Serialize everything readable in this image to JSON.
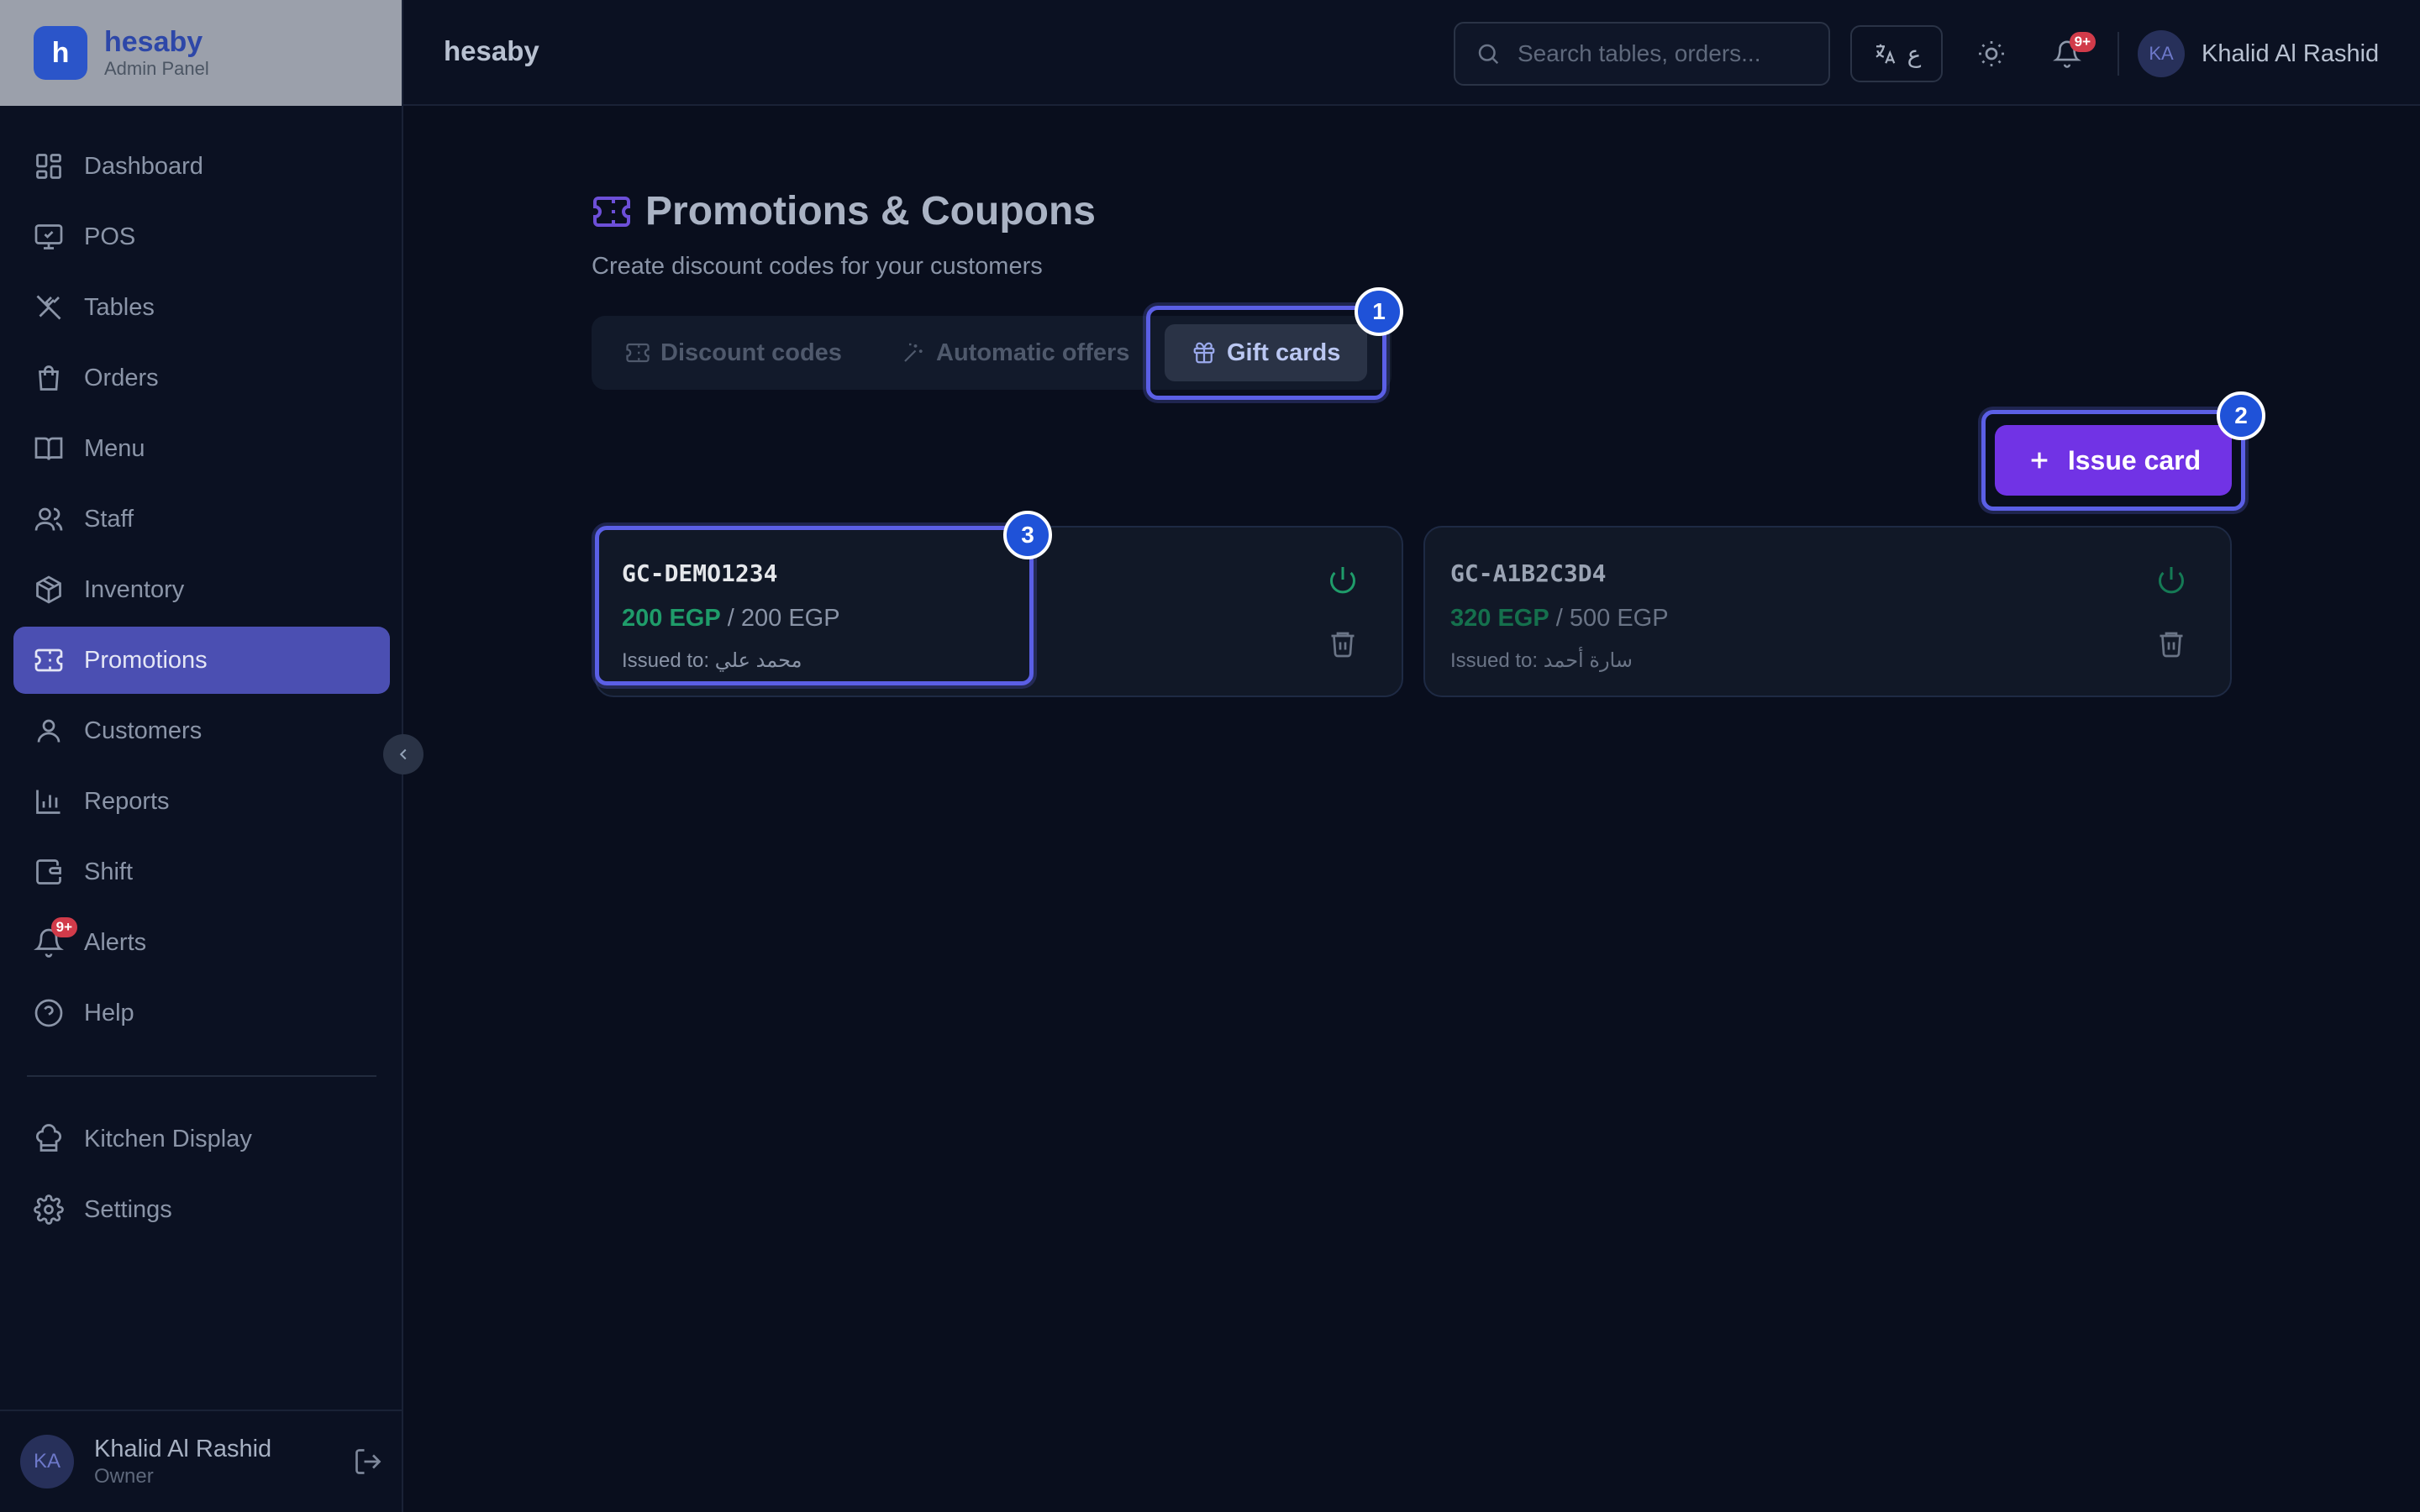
{
  "brand": {
    "logo_letter": "h",
    "name": "hesaby",
    "subtitle": "Admin Panel"
  },
  "sidebar": {
    "items": [
      {
        "label": "Dashboard",
        "icon": "dashboard-icon"
      },
      {
        "label": "POS",
        "icon": "pos-icon"
      },
      {
        "label": "Tables",
        "icon": "utensils-icon"
      },
      {
        "label": "Orders",
        "icon": "shopping-bag-icon"
      },
      {
        "label": "Menu",
        "icon": "book-icon"
      },
      {
        "label": "Staff",
        "icon": "users-icon"
      },
      {
        "label": "Inventory",
        "icon": "package-icon"
      },
      {
        "label": "Promotions",
        "icon": "ticket-icon",
        "active": true
      },
      {
        "label": "Customers",
        "icon": "user-icon"
      },
      {
        "label": "Reports",
        "icon": "bar-chart-icon"
      },
      {
        "label": "Shift",
        "icon": "wallet-icon"
      },
      {
        "label": "Alerts",
        "icon": "bell-icon",
        "badge": "9+"
      },
      {
        "label": "Help",
        "icon": "help-circle-icon"
      }
    ],
    "secondary": [
      {
        "label": "Kitchen Display",
        "icon": "chef-hat-icon"
      },
      {
        "label": "Settings",
        "icon": "gear-icon"
      }
    ],
    "user": {
      "initials": "KA",
      "name": "Khalid Al Rashid",
      "role": "Owner"
    }
  },
  "header": {
    "title": "hesaby",
    "search_placeholder": "Search tables, orders...",
    "lang_label": "ع",
    "notification_badge": "9+",
    "user": {
      "initials": "KA",
      "name": "Khalid Al Rashid"
    }
  },
  "page": {
    "title": "Promotions & Coupons",
    "subtitle": "Create discount codes for your customers",
    "tabs": [
      {
        "label": "Discount codes",
        "icon": "ticket-icon"
      },
      {
        "label": "Automatic offers",
        "icon": "sparkles-icon"
      },
      {
        "label": "Gift cards",
        "icon": "gift-icon",
        "active": true
      }
    ],
    "issue_button": "Issue card",
    "markers": [
      "1",
      "2",
      "3"
    ]
  },
  "gift_cards": [
    {
      "code": "GC-DEMO1234",
      "remaining": "200 EGP",
      "separator": "/",
      "total": "200 EGP",
      "issued_to": "Issued to: محمد علي",
      "code_color": "#e5e7eb"
    },
    {
      "code": "GC-A1B2C3D4",
      "remaining": "320 EGP",
      "separator": "/",
      "total": "500 EGP",
      "issued_to": "Issued to: سارة أحمد",
      "code_color": "#9aa3b3"
    }
  ],
  "colors": {
    "accent": "#7133e5",
    "active_nav": "#4b4fb2",
    "success": "#1f9c6a",
    "highlight": "#5b5fe6",
    "marker": "#1f52d8"
  }
}
